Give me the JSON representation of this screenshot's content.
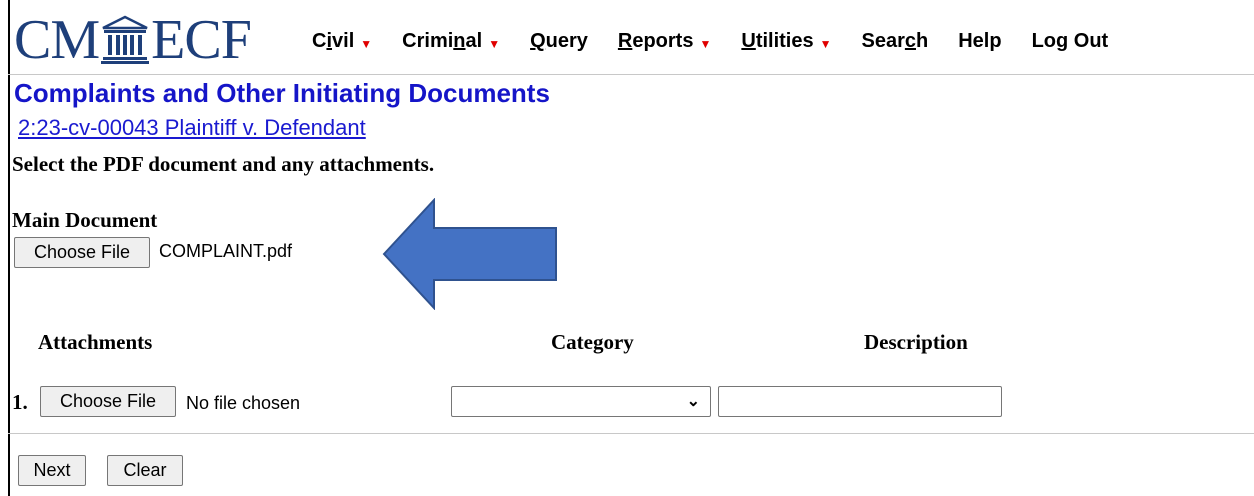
{
  "header": {
    "logo_left": "CM",
    "logo_right": "ECF",
    "logo_color": "#1e3f7a",
    "nav": [
      {
        "before": "C",
        "ul": "i",
        "after": "vil",
        "dropdown": true
      },
      {
        "before": "Crimi",
        "ul": "n",
        "after": "al",
        "dropdown": true
      },
      {
        "before": "",
        "ul": "Q",
        "after": "uery",
        "dropdown": false
      },
      {
        "before": "",
        "ul": "R",
        "after": "eports",
        "dropdown": true
      },
      {
        "before": "",
        "ul": "U",
        "after": "tilities",
        "dropdown": true
      },
      {
        "before": "Sear",
        "ul": "c",
        "after": "h",
        "dropdown": false
      },
      {
        "before": "Help",
        "ul": "",
        "after": "",
        "dropdown": false
      },
      {
        "before": "Log Out",
        "ul": "",
        "after": "",
        "dropdown": false
      }
    ],
    "caret_color": "#e00000"
  },
  "page": {
    "title": "Complaints and Other Initiating Documents",
    "case_link": "2:23-cv-00043 Plaintiff v. Defendant",
    "instructions": "Select the PDF document and any attachments."
  },
  "main_document": {
    "label": "Main Document",
    "button_label": "Choose File",
    "file_name": "COMPLAINT.pdf"
  },
  "annotation": {
    "arrow_color": "#4472c4",
    "arrow_stroke": "#2f528f"
  },
  "attachments": {
    "headers": {
      "attachments": "Attachments",
      "category": "Category",
      "description": "Description"
    },
    "rows": [
      {
        "number": "1.",
        "button_label": "Choose File",
        "status": "No file chosen",
        "category": "",
        "description": ""
      }
    ]
  },
  "actions": {
    "next": "Next",
    "clear": "Clear"
  }
}
